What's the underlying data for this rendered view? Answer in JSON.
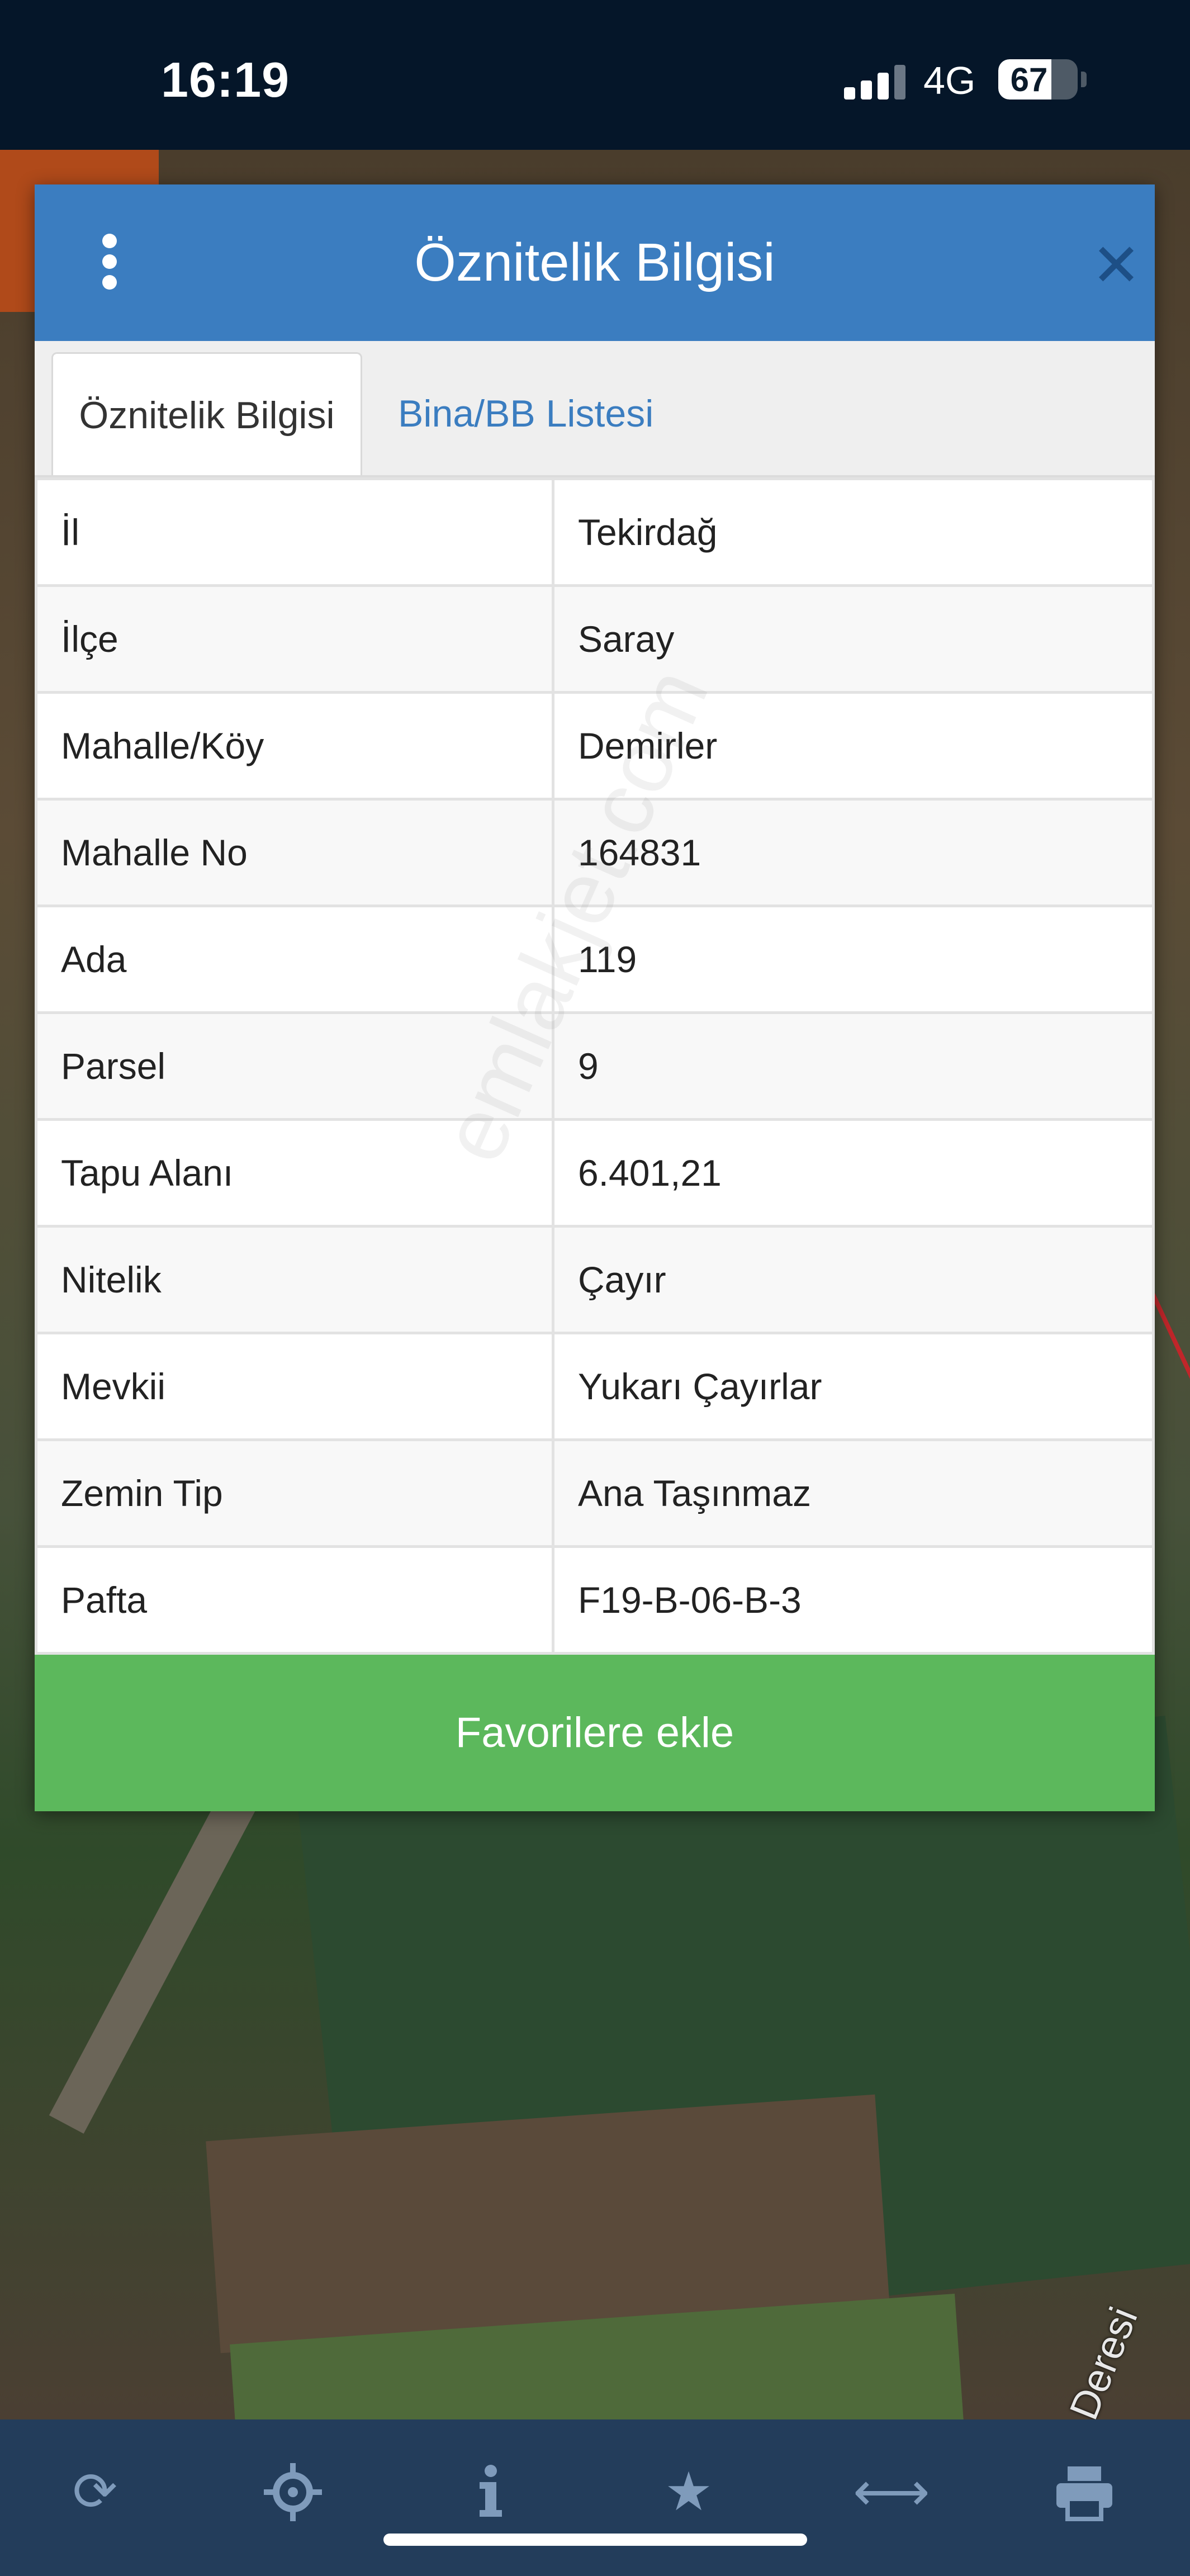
{
  "status_bar": {
    "time": "16:19",
    "network": "4G",
    "battery": "67",
    "battery_level": 0.67
  },
  "dialog": {
    "title": "Öznitelik Bilgisi",
    "menu_icon": "more-vertical-icon",
    "close_icon": "close-icon",
    "tabs": [
      {
        "label": "Öznitelik Bilgisi",
        "active": true
      },
      {
        "label": "Bina/BB Listesi",
        "active": false
      }
    ],
    "rows": [
      {
        "key": "İl",
        "value": "Tekirdağ"
      },
      {
        "key": "İlçe",
        "value": "Saray"
      },
      {
        "key": "Mahalle/Köy",
        "value": "Demirler"
      },
      {
        "key": "Mahalle No",
        "value": "164831"
      },
      {
        "key": "Ada",
        "value": "119"
      },
      {
        "key": "Parsel",
        "value": "9"
      },
      {
        "key": "Tapu Alanı",
        "value": "6.401,21"
      },
      {
        "key": "Nitelik",
        "value": "Çayır"
      },
      {
        "key": "Mevkii",
        "value": "Yukarı Çayırlar"
      },
      {
        "key": "Zemin Tip",
        "value": "Ana Taşınmaz"
      },
      {
        "key": "Pafta",
        "value": "F19-B-06-B-3"
      }
    ],
    "favorite_button": "Favorilere ekle"
  },
  "watermark": "emlakjet.com",
  "map": {
    "label": "valı Deresi"
  },
  "toolbar": {
    "icons": [
      "refresh-icon",
      "crosshair-icon",
      "info-icon",
      "star-icon",
      "measure-icon",
      "print-icon"
    ]
  },
  "colors": {
    "header": "#3b7dc0",
    "button": "#5cb85c",
    "toolbar": "#233d5b",
    "status_bar": "#051629"
  }
}
